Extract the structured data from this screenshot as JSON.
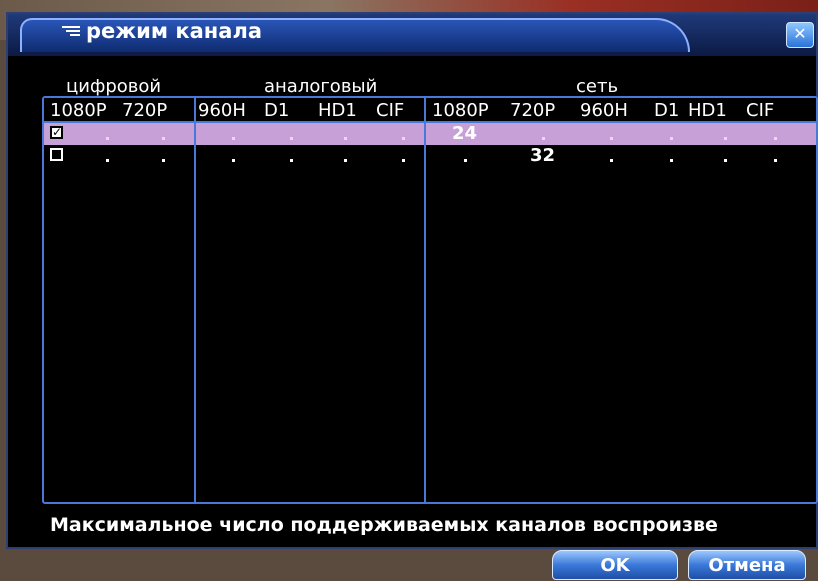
{
  "dialog": {
    "title": "режим канала",
    "close_icon": "close-icon"
  },
  "groups": {
    "digital": "цифровой",
    "analog": "аналоговый",
    "network": "сеть"
  },
  "columns": {
    "digital": [
      "1080P",
      "720P"
    ],
    "analog": [
      "960H",
      "D1",
      "HD1",
      "CIF"
    ],
    "network": [
      "1080P",
      "720P",
      "960H",
      "D1",
      "HD1",
      "CIF"
    ]
  },
  "rows": [
    {
      "checked": true,
      "network_720p": "24"
    },
    {
      "checked": false,
      "network_720p": "32"
    }
  ],
  "footer": {
    "info": "Максимальное число поддерживаемых каналов воспроизве",
    "ok_label": "OK",
    "cancel_label": "Отмена"
  },
  "colors": {
    "selected_row": "#c8a0d8",
    "border": "#4a78d8",
    "button": "#3a78d8"
  }
}
